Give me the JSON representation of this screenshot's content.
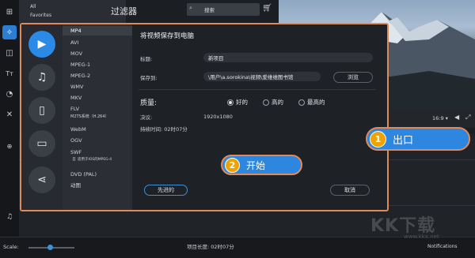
{
  "toolbar": {
    "items": [
      {
        "icon": "import-icon",
        "glyph": "⊞"
      },
      {
        "icon": "magic-wand-icon",
        "glyph": "✧"
      },
      {
        "icon": "filters-icon",
        "glyph": "◫"
      },
      {
        "icon": "titles-icon",
        "glyph": "Tт"
      },
      {
        "icon": "stickers-icon",
        "glyph": "◔"
      },
      {
        "icon": "tools-icon",
        "glyph": "✕"
      }
    ]
  },
  "filters": {
    "title": "过滤器",
    "categories": [
      "All",
      "Favorites"
    ],
    "search_placeholder": "搜索"
  },
  "player": {
    "aspect": "16:9 ▾"
  },
  "dialog": {
    "title": "将视频保存到电脑",
    "formats": [
      "MP4",
      "AVI",
      "MOV",
      "MPEG-1",
      "MPEG-2",
      "WMV",
      "MKV",
      "FLV",
      "M2TS系统（H.264）",
      "WebM",
      "OGV",
      "SWF",
      "【】适用于IOS的MPEG-4",
      "DVD (PAL)",
      "动图"
    ],
    "selected_format": "MP4",
    "filename_label": "标题:",
    "filename_value": "新项目",
    "save_to_label": "保存到:",
    "save_to_value": "\\用户\\a.sorokina\\视频\\爱维维图书馆",
    "browse_label": "浏览",
    "quality_label": "质量:",
    "quality_options": [
      "好的",
      "高的",
      "最高的"
    ],
    "quality_selected": "好的",
    "resolution_label": "决议:",
    "resolution_value": "1920x1080",
    "duration_label": "持续时间: 02时07分",
    "advanced_label": "先进的",
    "start_label": "开始",
    "cancel_label": "取消"
  },
  "callouts": {
    "export_num": "1",
    "export_label": "出口",
    "start_num": "2"
  },
  "timeline": {
    "project_length": "项目长度: 02时07分"
  },
  "statusbar": {
    "scale_label": "Scale:",
    "notifications": "Notifications"
  },
  "watermark": {
    "logo": "KK下载",
    "url": "www.kkx.net"
  }
}
